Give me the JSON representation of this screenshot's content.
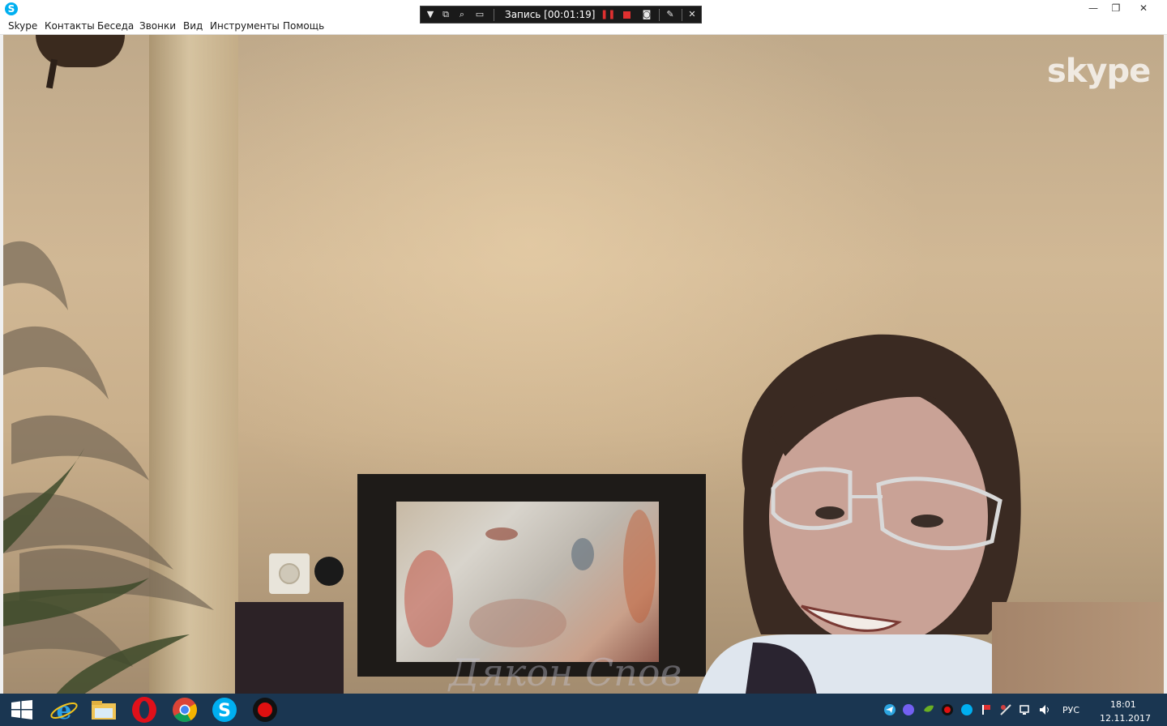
{
  "window": {
    "app_icon_letter": "S",
    "controls": {
      "minimize": "—",
      "restore": "❐",
      "close": "✕"
    }
  },
  "menu": [
    "Skype",
    "Контакты",
    "Беседа",
    "Звонки",
    "Вид",
    "Инструменты",
    "Помощь"
  ],
  "recorder": {
    "label": "Запись [00:01:19]",
    "icons": [
      "dropdown-icon",
      "restore-window-icon",
      "zoom-icon",
      "region-icon",
      "pause-icon",
      "stop-icon",
      "camera-icon",
      "pen-icon",
      "close-icon"
    ],
    "colors": {
      "pause": "#e03030",
      "stop": "#e03030"
    }
  },
  "video": {
    "brand_logo": "skype",
    "watermark": "Дякон Спов"
  },
  "taskbar": {
    "apps": [
      "internet-explorer-icon",
      "file-explorer-icon",
      "opera-icon",
      "chrome-icon",
      "skype-icon",
      "record-icon"
    ],
    "tray": {
      "language": "РУС",
      "time": "18:01",
      "date": "12.11.2017"
    }
  },
  "colors": {
    "accent": "#00aff0",
    "taskbar": "#1a3651",
    "record_red": "#e01010"
  }
}
